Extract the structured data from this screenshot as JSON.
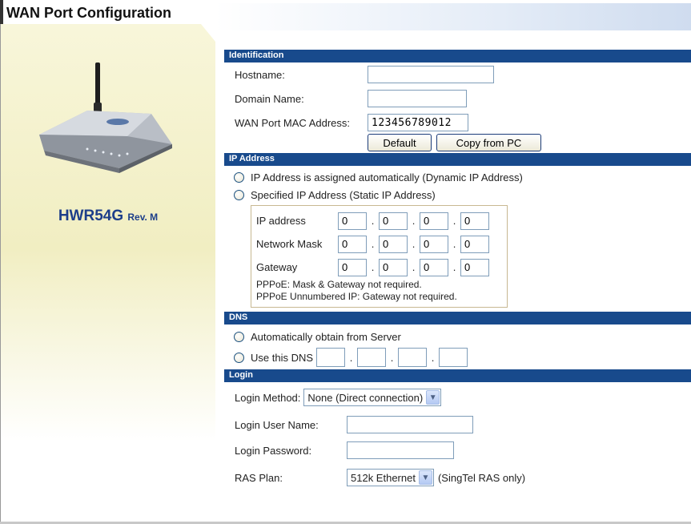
{
  "page": {
    "title": "WAN Port Configuration"
  },
  "device": {
    "model": "HWR54G",
    "revision": "Rev. M",
    "image_icon": "router-icon"
  },
  "identification": {
    "header": "Identification",
    "hostname_label": "Hostname:",
    "hostname_value": "",
    "domain_label": "Domain Name:",
    "domain_value": "",
    "mac_label": "WAN Port MAC Address:",
    "mac_value": "123456789012",
    "default_button": "Default",
    "copy_button": "Copy from PC"
  },
  "ip_address": {
    "header": "IP Address",
    "dynamic_option": "IP Address is assigned automatically (Dynamic IP Address)",
    "static_option": "Specified IP Address (Static IP Address)",
    "ip_label": "IP address",
    "ip": [
      "0",
      "0",
      "0",
      "0"
    ],
    "mask_label": "Network Mask",
    "mask": [
      "0",
      "0",
      "0",
      "0"
    ],
    "gateway_label": "Gateway",
    "gateway": [
      "0",
      "0",
      "0",
      "0"
    ],
    "note1": "PPPoE: Mask & Gateway not required.",
    "note2": "PPPoE Unnumbered IP: Gateway not required."
  },
  "dns": {
    "header": "DNS",
    "auto_option": "Automatically obtain from Server",
    "manual_option": "Use this DNS",
    "octets": [
      "",
      "",
      "",
      ""
    ]
  },
  "login": {
    "header": "Login",
    "method_label": "Login Method:",
    "method_value": "None (Direct connection)",
    "user_label": "Login User Name:",
    "user_value": "",
    "password_label": "Login Password:",
    "password_value": "",
    "ras_label": "RAS Plan:",
    "ras_value": "512k Ethernet",
    "ras_note": "(SingTel RAS only)"
  },
  "colors": {
    "section_header": "#184a8c",
    "model_text": "#1d3e8a",
    "panel_yellow": "#f1eec2"
  }
}
